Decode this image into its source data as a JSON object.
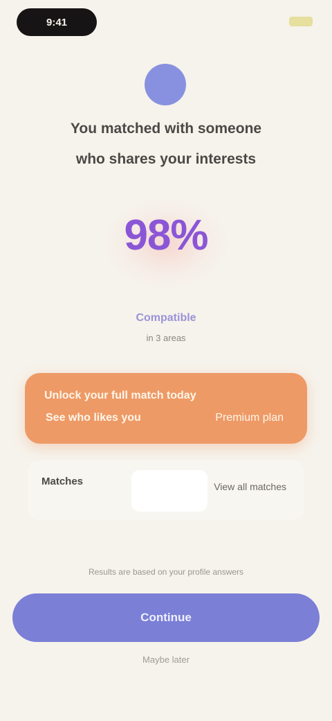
{
  "status_bar": {
    "time": "9:41",
    "battery_color": "#e6df9e"
  },
  "profile": {
    "initial": ""
  },
  "headline": {
    "line1": "You matched with someone",
    "line2": "who shares your interests"
  },
  "match": {
    "percent": "98%",
    "label": "Compatible",
    "sublabel": "in 3 areas"
  },
  "offer_card": {
    "line1": "Unlock your full match today",
    "line2": "See who likes you",
    "line3": "Premium plan"
  },
  "stats": {
    "left": "Matches",
    "right": "View all matches"
  },
  "disclaimer": "Results are based on your profile answers",
  "cta": {
    "label": "Continue"
  },
  "footer": {
    "link": "Maybe later"
  },
  "colors": {
    "background": "#f6f3ec",
    "accent_purple": "#7b7fd6",
    "percent_purple": "#8b56d6",
    "orange": "#ee9a66"
  }
}
